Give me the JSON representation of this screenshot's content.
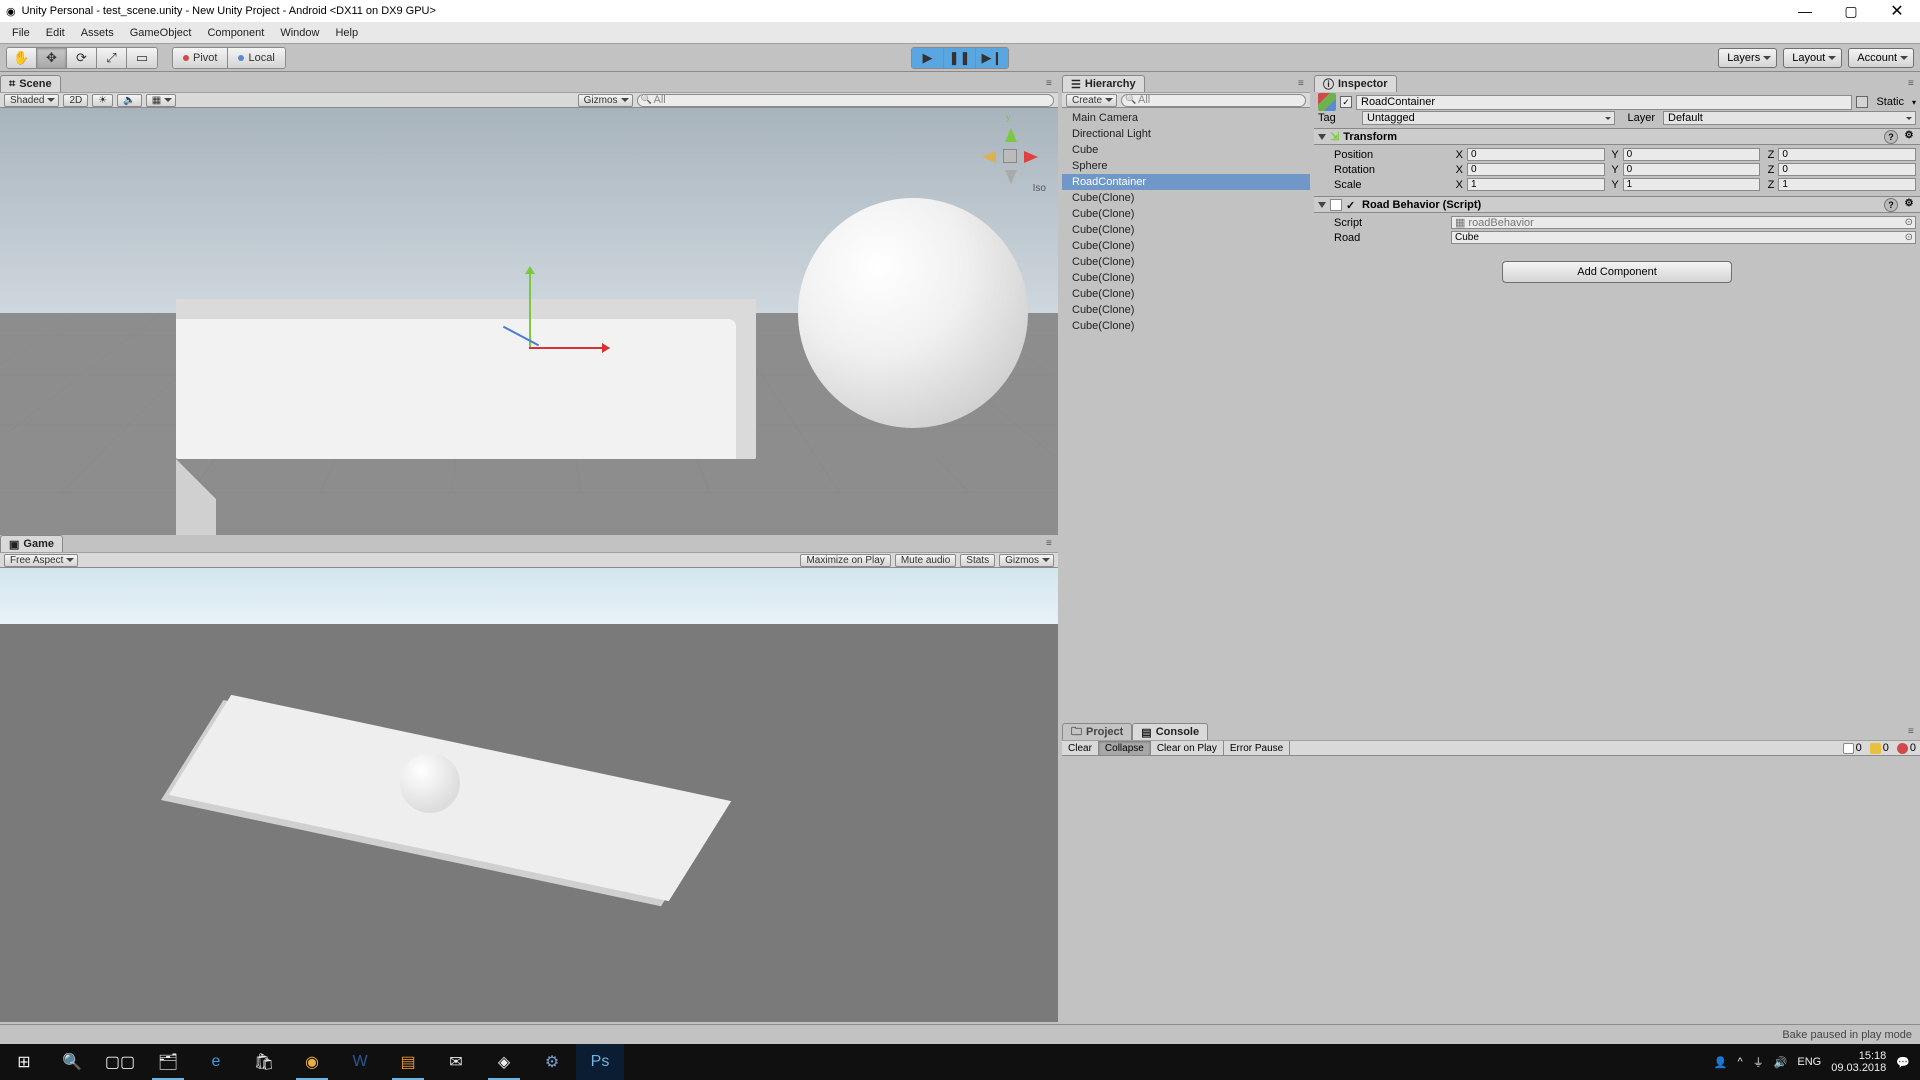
{
  "title": "Unity Personal - test_scene.unity - New Unity Project - Android <DX11 on DX9 GPU>",
  "menu": [
    "File",
    "Edit",
    "Assets",
    "GameObject",
    "Component",
    "Window",
    "Help"
  ],
  "toolbar": {
    "pivot": "Pivot",
    "local": "Local",
    "layers": "Layers",
    "layout": "Layout",
    "account": "Account"
  },
  "scene": {
    "tab": "Scene",
    "shaded": "Shaded",
    "btn2d": "2D",
    "gizmos": "Gizmos",
    "search": "All",
    "iso": "Iso",
    "axisY": "y"
  },
  "game": {
    "tab": "Game",
    "aspect": "Free Aspect",
    "maxplay": "Maximize on Play",
    "mute": "Mute audio",
    "stats": "Stats",
    "gizmos": "Gizmos"
  },
  "hierarchy": {
    "tab": "Hierarchy",
    "create": "Create",
    "search": "All",
    "items": [
      "Main Camera",
      "Directional Light",
      "Cube",
      "Sphere",
      "RoadContainer",
      "Cube(Clone)",
      "Cube(Clone)",
      "Cube(Clone)",
      "Cube(Clone)",
      "Cube(Clone)",
      "Cube(Clone)",
      "Cube(Clone)",
      "Cube(Clone)",
      "Cube(Clone)"
    ],
    "selected": 4
  },
  "inspector": {
    "tab": "Inspector",
    "name": "RoadContainer",
    "static": "Static",
    "tag_lbl": "Tag",
    "tag_val": "Untagged",
    "layer_lbl": "Layer",
    "layer_val": "Default",
    "transform": {
      "title": "Transform",
      "pos": "Position",
      "rot": "Rotation",
      "scale": "Scale",
      "px": "0",
      "py": "0",
      "pz": "0",
      "rx": "0",
      "ry": "0",
      "rz": "0",
      "sx": "1",
      "sy": "1",
      "sz": "1"
    },
    "roadbeh": {
      "title": "Road Behavior (Script)",
      "script_lbl": "Script",
      "script_val": "roadBehavior",
      "road_lbl": "Road",
      "road_val": "Cube"
    },
    "addcomp": "Add Component"
  },
  "lower": {
    "project": "Project",
    "console": "Console",
    "clear": "Clear",
    "collapse": "Collapse",
    "clearplay": "Clear on Play",
    "errpause": "Error Pause",
    "c0": "0",
    "c1": "0",
    "c2": "0"
  },
  "status": "Bake paused in play mode",
  "tray": {
    "lang": "ENG",
    "time": "15:18",
    "date": "09.03.2018"
  }
}
